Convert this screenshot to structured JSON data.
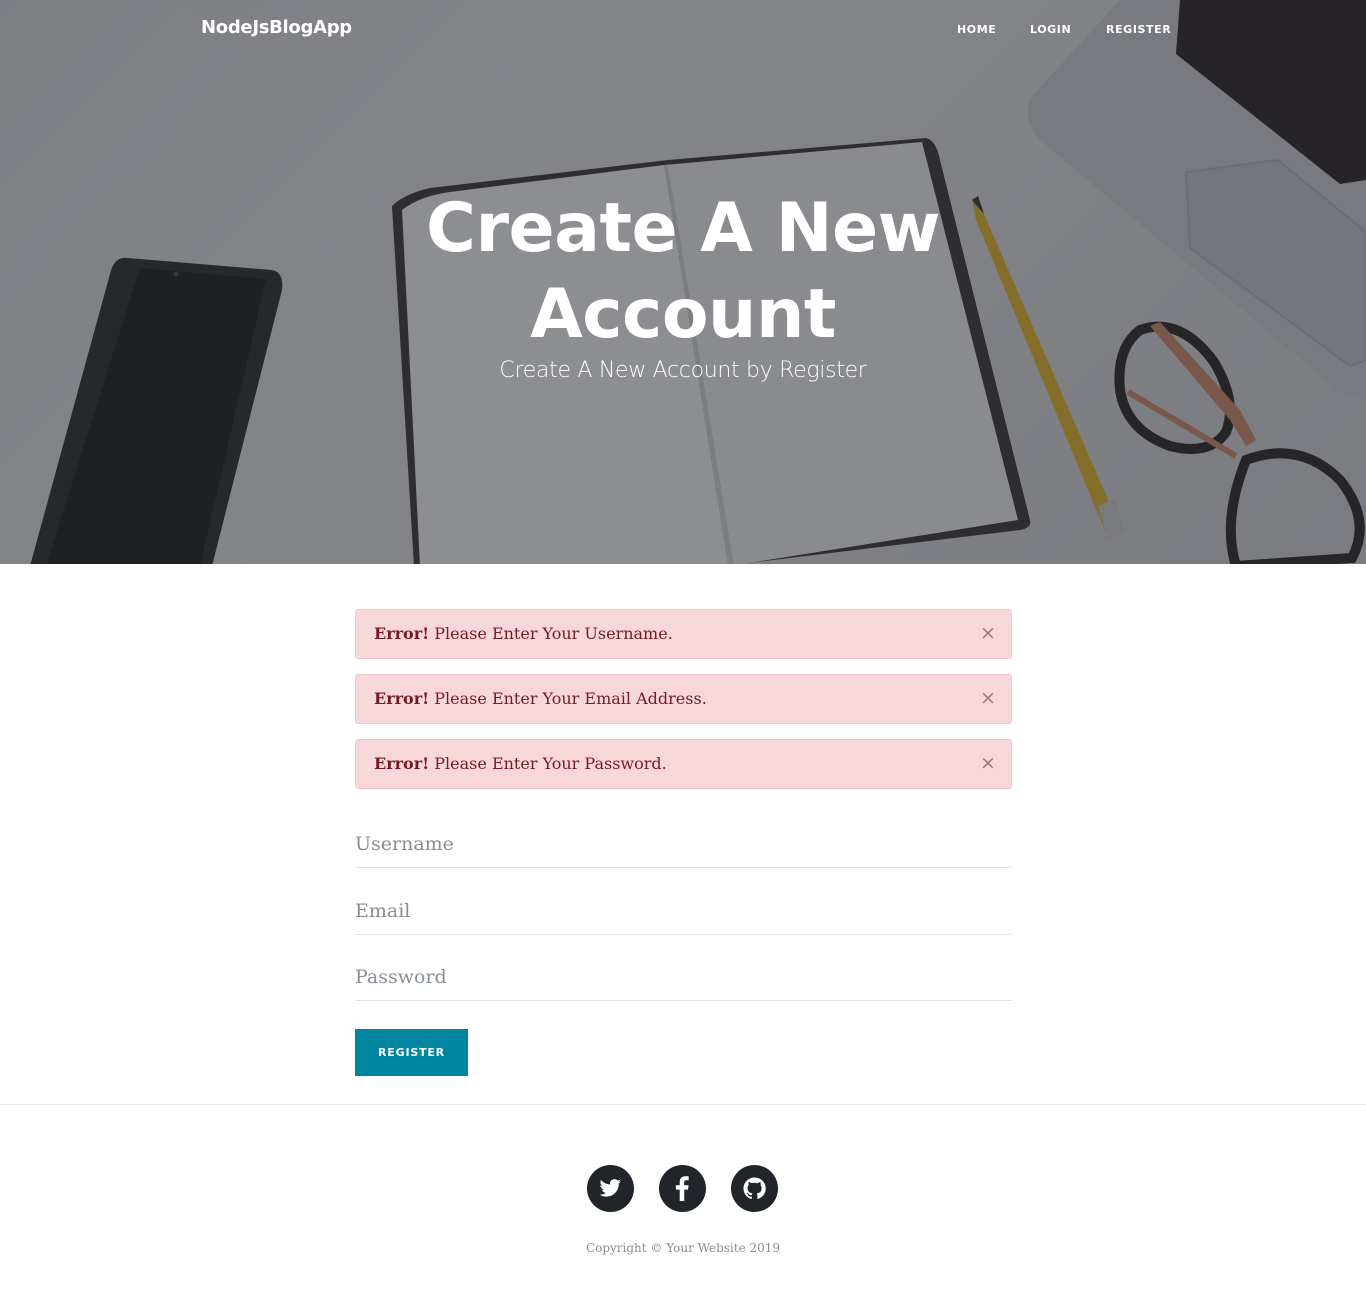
{
  "navbar": {
    "brand": "NodeJsBlogApp",
    "links": [
      {
        "label": "HOME"
      },
      {
        "label": "LOGIN"
      },
      {
        "label": "REGISTER"
      }
    ]
  },
  "hero": {
    "heading_line1": "Create A New",
    "heading_line2": "Account",
    "subheading": "Create A New Account by Register"
  },
  "alerts": [
    {
      "strong": "Error!",
      "message": "Please Enter Your Username.",
      "close": "×"
    },
    {
      "strong": "Error!",
      "message": "Please Enter Your Email Address.",
      "close": "×"
    },
    {
      "strong": "Error!",
      "message": "Please Enter Your Password.",
      "close": "×"
    }
  ],
  "form": {
    "username": {
      "value": "",
      "placeholder": "Username"
    },
    "email": {
      "value": "",
      "placeholder": "Email"
    },
    "password": {
      "value": "",
      "placeholder": "Password"
    },
    "submit_label": "REGISTER"
  },
  "footer": {
    "social": [
      {
        "icon": "twitter-icon"
      },
      {
        "icon": "facebook-icon"
      },
      {
        "icon": "github-icon"
      }
    ],
    "copyright": "Copyright © Your Website 2019"
  },
  "colors": {
    "accent": "#0085a1",
    "alert_bg": "#f8d7da",
    "alert_text": "#721c24",
    "footer_icon_bg": "#212529"
  }
}
